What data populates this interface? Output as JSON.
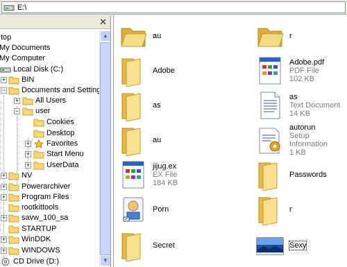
{
  "address": {
    "path": "E:\\"
  },
  "tree": {
    "items": [
      {
        "label": "top",
        "expander": ""
      },
      {
        "label": "My Documents",
        "expander": ""
      },
      {
        "label": "My Computer",
        "expander": ""
      },
      {
        "label": "Local Disk (C:)",
        "expander": "-"
      },
      {
        "label": "BIN",
        "expander": "+"
      },
      {
        "label": "Documents and Settings",
        "expander": "-"
      },
      {
        "label": "All Users",
        "expander": "+"
      },
      {
        "label": "user",
        "expander": "-"
      },
      {
        "label": "Cookies",
        "expander": ""
      },
      {
        "label": "Desktop",
        "expander": ""
      },
      {
        "label": "Favorites",
        "expander": "+"
      },
      {
        "label": "Start Menu",
        "expander": "+"
      },
      {
        "label": "UserData",
        "expander": "+"
      },
      {
        "label": "NV",
        "expander": "+"
      },
      {
        "label": "Powerarchiver",
        "expander": "+"
      },
      {
        "label": "Program Files",
        "expander": "+"
      },
      {
        "label": "rootkittools",
        "expander": ""
      },
      {
        "label": "savw_100_sa",
        "expander": "+"
      },
      {
        "label": "STARTUP",
        "expander": ""
      },
      {
        "label": "WinDDK",
        "expander": "+"
      },
      {
        "label": "WINDOWS",
        "expander": "+"
      },
      {
        "label": "CD Drive (D:)",
        "expander": ""
      }
    ]
  },
  "files": [
    {
      "name": "au",
      "type": "",
      "size": "",
      "icon": "folder-open-icon"
    },
    {
      "name": "r",
      "type": "",
      "size": "",
      "icon": "folder-open-icon"
    },
    {
      "name": "Adobe",
      "type": "",
      "size": "",
      "icon": "folder-icon"
    },
    {
      "name": "Adobe.pdf",
      "type": "PDF File",
      "size": "102 KB",
      "icon": "application-file-icon"
    },
    {
      "name": "as",
      "type": "",
      "size": "",
      "icon": "folder-icon"
    },
    {
      "name": "as",
      "type": "Text Document",
      "size": "14 KB",
      "icon": "text-document-icon"
    },
    {
      "name": "au",
      "type": "",
      "size": "",
      "icon": "folder-icon"
    },
    {
      "name": "autorun",
      "type": "Setup Information",
      "size": "1 KB",
      "icon": "setup-information-icon"
    },
    {
      "name": "jijug.ex",
      "type": "EX File",
      "size": "184 KB",
      "icon": "application-file-icon"
    },
    {
      "name": "Passwords",
      "type": "",
      "size": "",
      "icon": "folder-icon"
    },
    {
      "name": "Porn",
      "type": "",
      "size": "",
      "icon": "media-shortcut-icon"
    },
    {
      "name": "r",
      "type": "",
      "size": "",
      "icon": "folder-icon"
    },
    {
      "name": "Secret",
      "type": "",
      "size": "",
      "icon": "folder-icon"
    },
    {
      "name": "Sexy",
      "type": "",
      "size": "",
      "icon": "image-thumbnail-icon"
    }
  ],
  "colors": {
    "folder": "#f5d67d",
    "folder_dark": "#d8a935",
    "chrome": "#ece9d8",
    "scroll": "#c6d6fc"
  }
}
